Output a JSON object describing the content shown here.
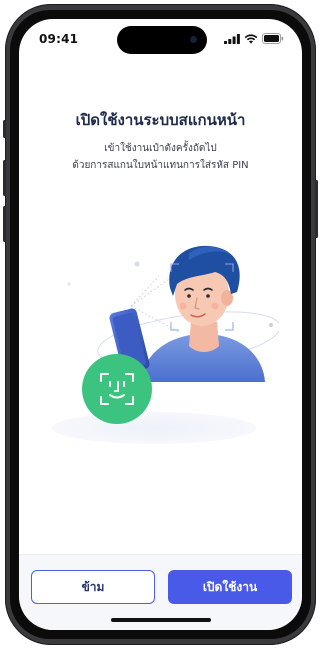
{
  "status_bar": {
    "time": "09:41",
    "icons": [
      "signal-icon",
      "wifi-icon",
      "battery-icon"
    ]
  },
  "content": {
    "title": "เปิดใช้งานระบบสแกนหน้า",
    "subtitle_line1": "เข้าใช้งานเป๋าตังครั้งถัดไป",
    "subtitle_line2": "ด้วยการสแกนใบหน้าแทนการใส่รหัส PIN",
    "illustration": "face-scan-illustration"
  },
  "actions": {
    "skip_label": "ข้าม",
    "enable_label": "เปิดใช้งาน"
  },
  "colors": {
    "primary": "#4a5ae8",
    "title": "#1e2b4a",
    "face_id_green": "#3cc37f",
    "hair": "#1f4fa0"
  }
}
